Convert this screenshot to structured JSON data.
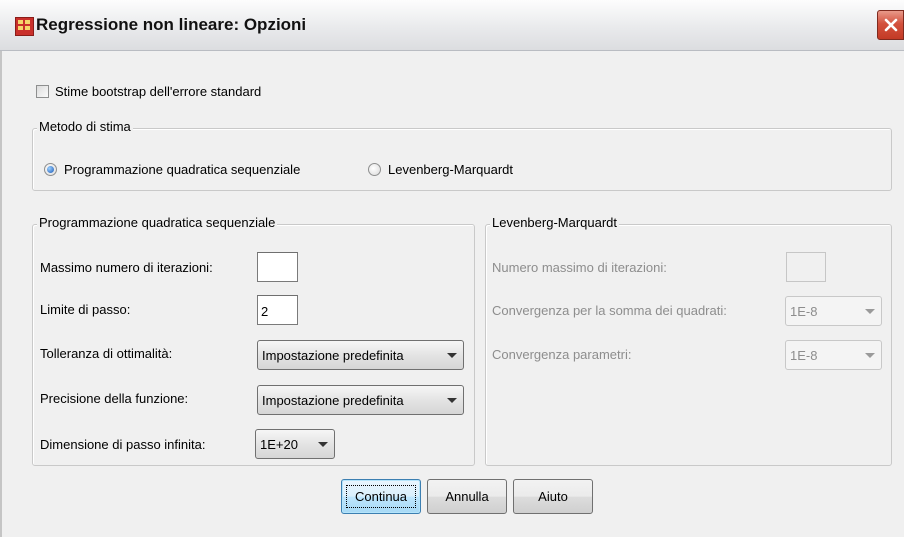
{
  "window": {
    "title": "Regressione non lineare: Opzioni",
    "close_icon": "close-icon"
  },
  "bootstrap": {
    "label": "Stime bootstrap dell'errore standard",
    "checked": false
  },
  "method": {
    "legend": "Metodo di stima",
    "option_sqp": "Programmazione quadratica sequenziale",
    "option_lm": "Levenberg-Marquardt",
    "selected": "Programmazione quadratica sequenziale"
  },
  "sqp": {
    "legend": "Programmazione quadratica sequenziale",
    "max_iter_label": "Massimo numero di iterazioni:",
    "max_iter_value": "",
    "step_limit_label": "Limite di passo:",
    "step_limit_value": "2",
    "optimality_tol_label": "Tolleranza di ottimalità:",
    "optimality_tol_value": "Impostazione predefinita",
    "function_precision_label": "Precisione della funzione:",
    "function_precision_value": "Impostazione predefinita",
    "infinite_step_label": "Dimensione di passo infinita:",
    "infinite_step_value": "1E+20"
  },
  "lm": {
    "legend": "Levenberg-Marquardt",
    "max_iter_label": "Numero massimo di iterazioni:",
    "max_iter_value": "",
    "ssq_convergence_label": "Convergenza per la somma dei quadrati:",
    "ssq_convergence_value": "1E-8",
    "param_convergence_label": "Convergenza parametri:",
    "param_convergence_value": "1E-8"
  },
  "buttons": {
    "continue": "Continua",
    "cancel": "Annulla",
    "help": "Aiuto"
  },
  "colors": {
    "titlebar": "#e9eaec",
    "close": "#c33a25",
    "dialog_bg": "#f0f0f0",
    "default_button": "#bee6fd"
  }
}
